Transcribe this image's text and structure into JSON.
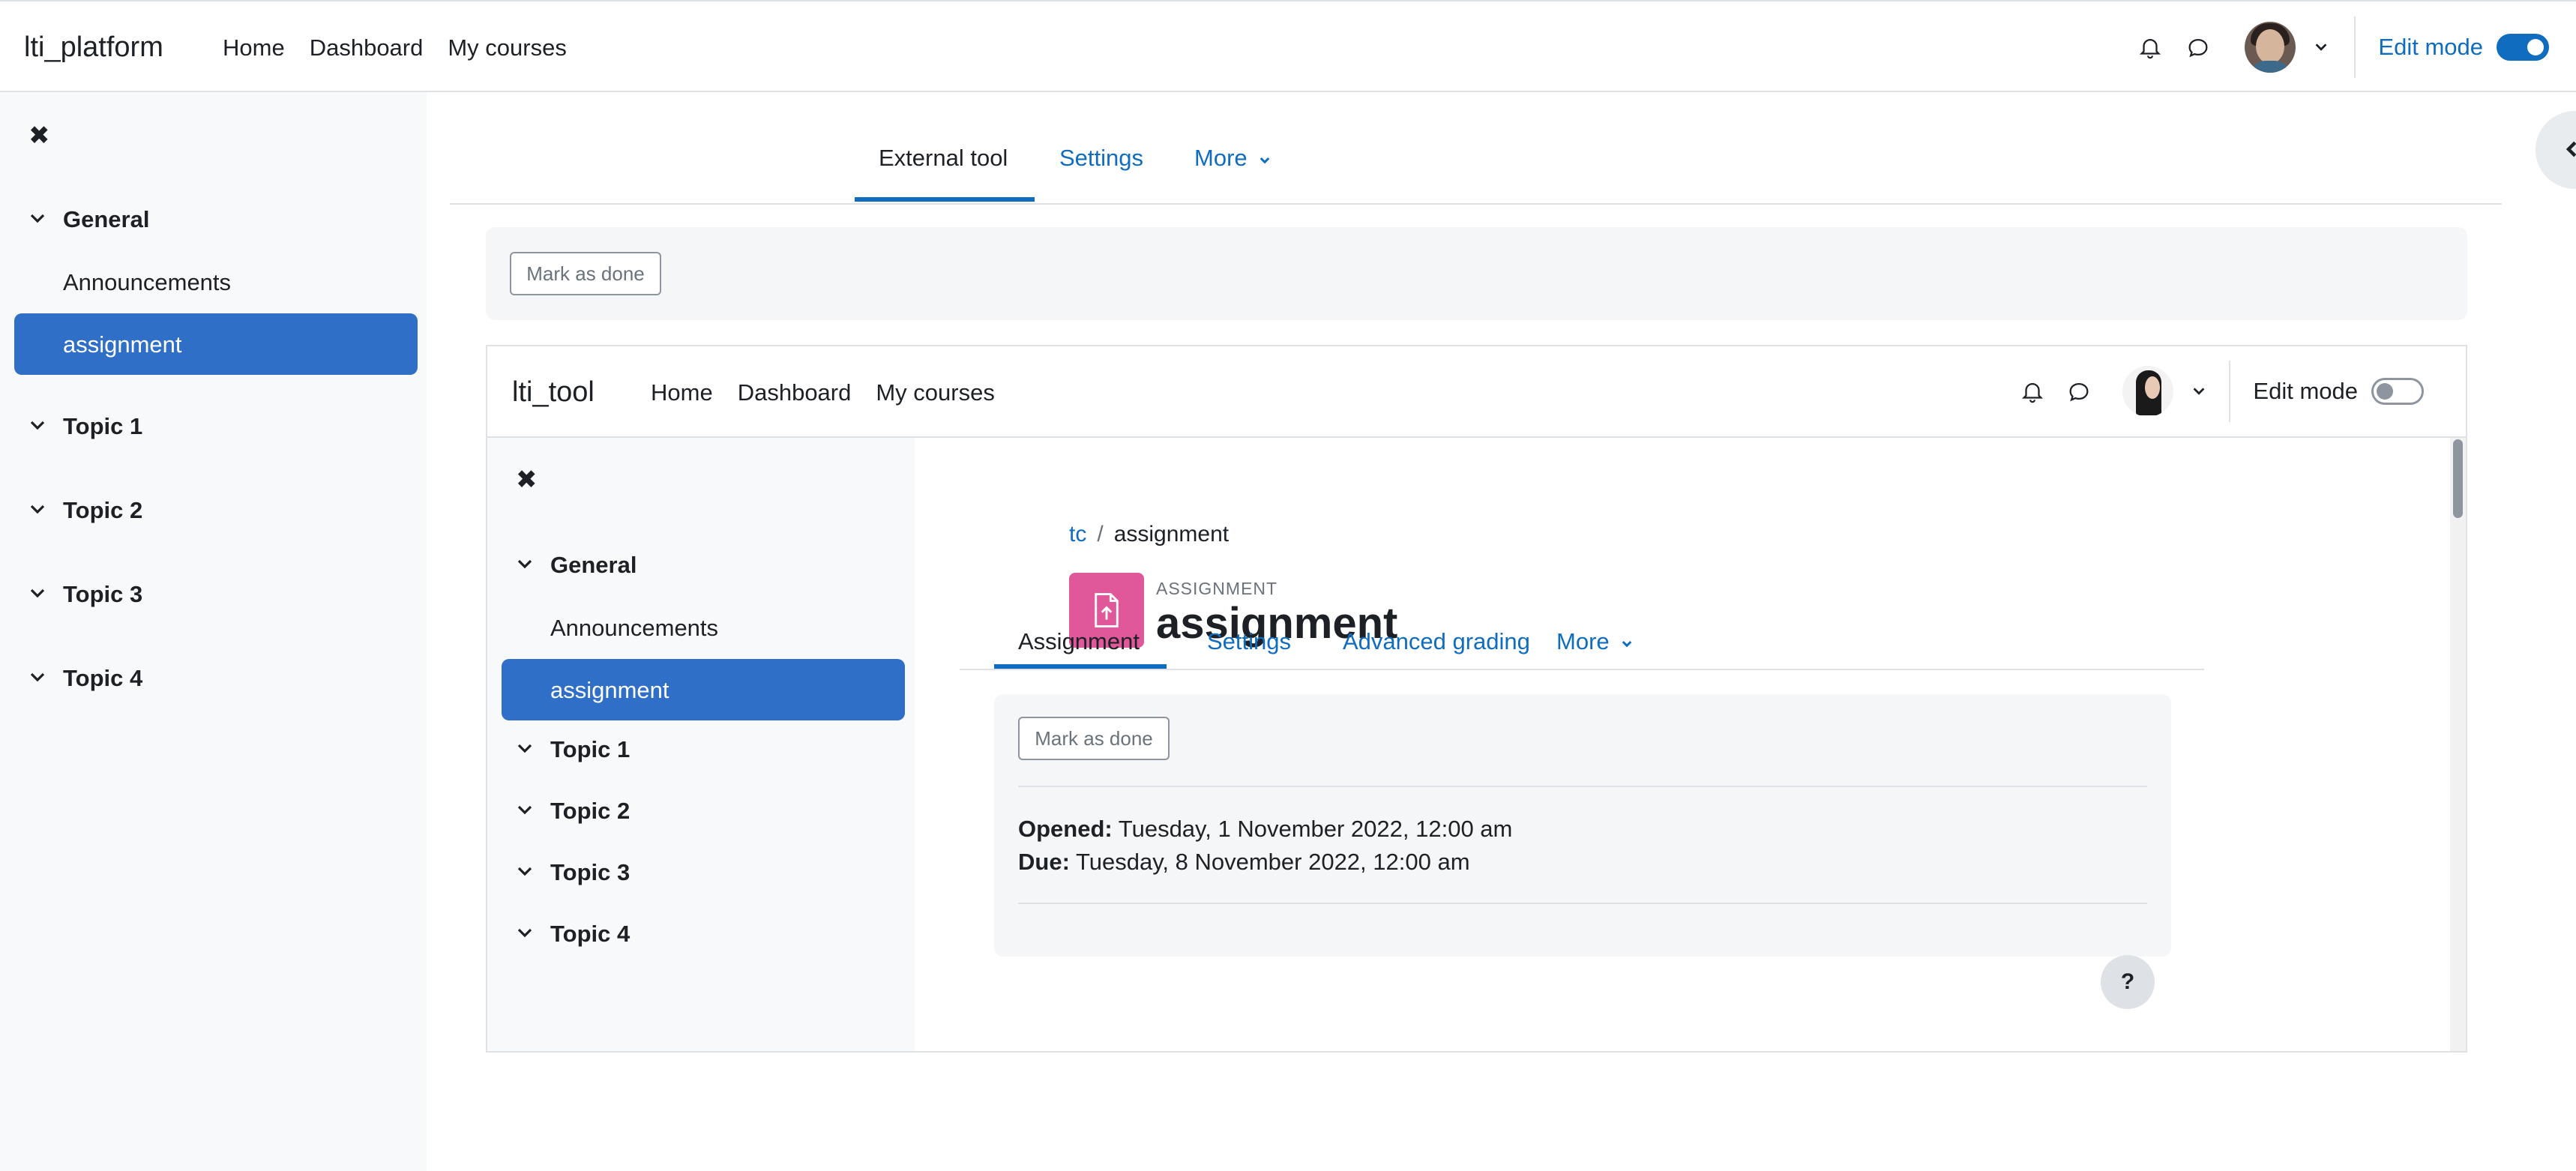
{
  "navbar": {
    "brand": "lti_platform",
    "links": [
      "Home",
      "Dashboard",
      "My courses"
    ],
    "edit_mode_label": "Edit mode",
    "edit_mode_on": true
  },
  "drawer": {
    "sections": [
      {
        "label": "General",
        "expanded": true,
        "items": [
          {
            "label": "Announcements",
            "active": false
          },
          {
            "label": "assignment",
            "active": true
          }
        ]
      },
      {
        "label": "Topic 1",
        "expanded": true,
        "items": []
      },
      {
        "label": "Topic 2",
        "expanded": true,
        "items": []
      },
      {
        "label": "Topic 3",
        "expanded": true,
        "items": []
      },
      {
        "label": "Topic 4",
        "expanded": true,
        "items": []
      }
    ]
  },
  "secondary_nav": {
    "tabs": [
      {
        "label": "External tool",
        "active": true
      },
      {
        "label": "Settings",
        "active": false
      },
      {
        "label": "More",
        "active": false
      }
    ]
  },
  "activity_header": {
    "mark_done_label": "Mark as done"
  },
  "tool": {
    "navbar": {
      "brand": "lti_tool",
      "links": [
        "Home",
        "Dashboard",
        "My courses"
      ],
      "edit_mode_label": "Edit mode",
      "edit_mode_on": false
    },
    "drawer": {
      "sections": [
        {
          "label": "General",
          "items": [
            {
              "label": "Announcements",
              "active": false
            },
            {
              "label": "assignment",
              "active": true
            }
          ]
        },
        {
          "label": "Topic 1",
          "items": []
        },
        {
          "label": "Topic 2",
          "items": []
        },
        {
          "label": "Topic 3",
          "items": []
        },
        {
          "label": "Topic 4",
          "items": []
        }
      ]
    },
    "breadcrumb": [
      "tc",
      "assignment"
    ],
    "module_type": "ASSIGNMENT",
    "module_title": "assignment",
    "module_icon": "file-upload-icon",
    "tabs": [
      {
        "label": "Assignment",
        "active": true
      },
      {
        "label": "Settings",
        "active": false
      },
      {
        "label": "Advanced grading",
        "active": false
      },
      {
        "label": "More",
        "active": false
      }
    ],
    "mark_done_label": "Mark as done",
    "dates": {
      "opened_label": "Opened:",
      "opened_value": "Tuesday, 1 November 2022, 12:00 am",
      "due_label": "Due:",
      "due_value": "Tuesday, 8 November 2022, 12:00 am"
    },
    "help_label": "?"
  },
  "colors": {
    "accent": "#0f6cbf",
    "active_item": "#2f6fc8",
    "module_icon_bg": "#e0589a",
    "drawer_bg": "#f8f9fa"
  }
}
